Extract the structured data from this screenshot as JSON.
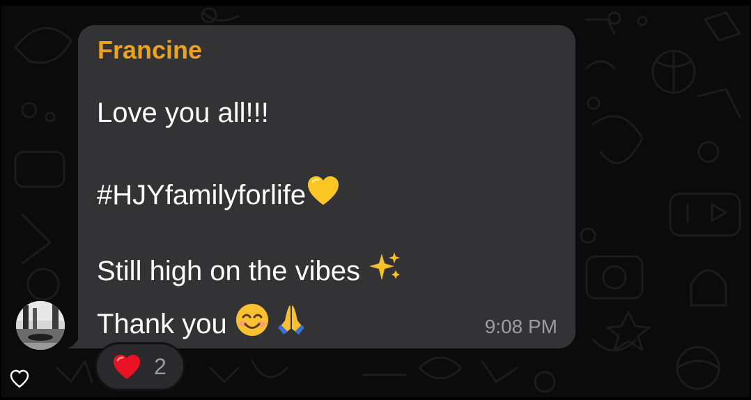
{
  "message": {
    "sender": "Francine",
    "lines": {
      "line1": "Love you all!!!",
      "line2": "#HJYfamilyforlife",
      "line3": "Still high on the vibes ",
      "line4": "Thank you "
    },
    "emojis": [
      "yellow-heart",
      "sparkles",
      "smiling-face",
      "folded-hands"
    ],
    "time": "9:08 PM"
  },
  "reaction": {
    "emoji": "red-heart",
    "count": "2"
  },
  "colors": {
    "sender_name": "#e9a321",
    "bubble": "#333335",
    "timestamp": "#9e9ea2",
    "background": "#0b0b0b"
  }
}
